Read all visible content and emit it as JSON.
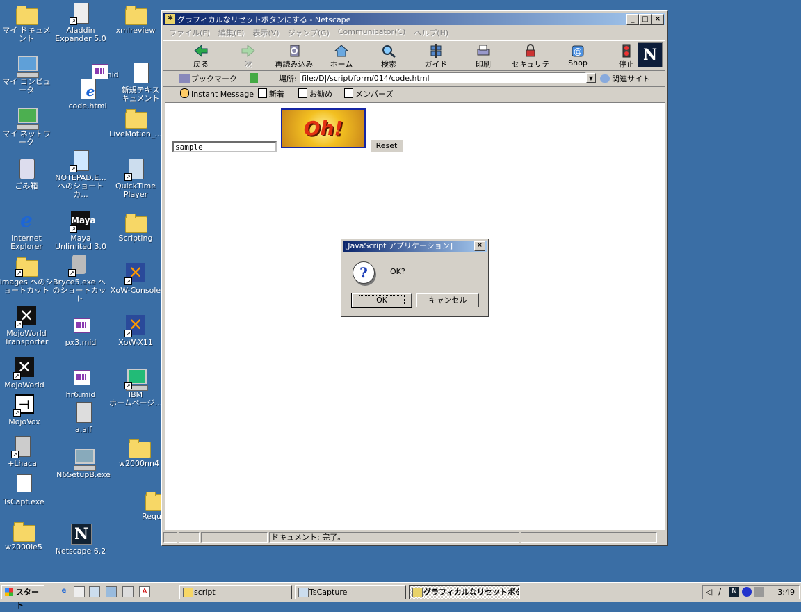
{
  "desktop": {
    "icons": [
      {
        "label": "マイ ドキュメント"
      },
      {
        "label": "マイ コンピュータ"
      },
      {
        "label": "マイ ネットワーク"
      },
      {
        "label": "ごみ箱"
      },
      {
        "label": "Internet\nExplorer"
      },
      {
        "label": "images へのシ\nョートカット"
      },
      {
        "label": "MojoWorld\nTransporter"
      },
      {
        "label": "MojoWorld"
      },
      {
        "label": "MojoVox"
      },
      {
        "label": "+Lhaca"
      },
      {
        "label": "TsCapt.exe"
      },
      {
        "label": "w2000ie5"
      },
      {
        "label": "Aladdin\nExpander 5.0"
      },
      {
        "label": "code.html"
      },
      {
        "label": "NOTEPAD.E...\nへのショートカ..."
      },
      {
        "label": "Maya\nUnlimited 3.0"
      },
      {
        "label": "Bryce5.exe へ\nのショートカット"
      },
      {
        "label": "px3.mid"
      },
      {
        "label": "hr6.mid"
      },
      {
        "label": "a.aif"
      },
      {
        "label": "N6SetupB.exe"
      },
      {
        "label": "Netscape 6.2"
      },
      {
        "label": "xmlreview"
      },
      {
        "label": "0.mid"
      },
      {
        "label": "新規テキス\nキュメント"
      },
      {
        "label": "LiveMotion_..."
      },
      {
        "label": "QuickTime\nPlayer"
      },
      {
        "label": "Scripting"
      },
      {
        "label": "XoW-Console"
      },
      {
        "label": "XoW-X11"
      },
      {
        "label": "IBM\nホームページ..."
      },
      {
        "label": "w2000nn4"
      },
      {
        "label": "Requ"
      }
    ]
  },
  "window": {
    "title": "グラフィカルなリセットボタンにする - Netscape",
    "menu": [
      "ファイル(F)",
      "編集(E)",
      "表示(V)",
      "ジャンプ(G)",
      "Communicator(C)",
      "ヘルプ(H)"
    ],
    "toolbar": [
      {
        "label": "戻る",
        "icon": "back-arrow-icon"
      },
      {
        "label": "次",
        "icon": "forward-arrow-icon"
      },
      {
        "label": "再読み込み",
        "icon": "reload-icon"
      },
      {
        "label": "ホーム",
        "icon": "home-icon"
      },
      {
        "label": "検索",
        "icon": "search-icon"
      },
      {
        "label": "ガイド",
        "icon": "guide-icon"
      },
      {
        "label": "印刷",
        "icon": "print-icon"
      },
      {
        "label": "セキュリティ",
        "icon": "lock-icon"
      },
      {
        "label": "Shop",
        "icon": "shop-icon"
      },
      {
        "label": "停止",
        "icon": "stop-icon"
      }
    ],
    "logo": "N",
    "location": {
      "bookmarks_label": "ブックマーク",
      "label": "場所:",
      "value": "file:/D|/script/form/014/code.html",
      "related_label": "関連サイト"
    },
    "personal_toolbar": [
      "Instant Message",
      "新着",
      "お勧め",
      "メンバーズ"
    ],
    "page": {
      "text_value": "sample",
      "image_text": "Oh!",
      "reset_label": "Reset"
    },
    "status": "ドキュメント: 完了。"
  },
  "dialog": {
    "title": "[JavaScript アプリケーション]",
    "message": "OK?",
    "ok_label": "OK",
    "cancel_label": "キャンセル"
  },
  "taskbar": {
    "start_label": "スタート",
    "tasks": [
      {
        "label": "script"
      },
      {
        "label": "TsCapture"
      },
      {
        "label": "グラフィカルなリセットボタ..."
      }
    ],
    "clock": "3:49"
  }
}
